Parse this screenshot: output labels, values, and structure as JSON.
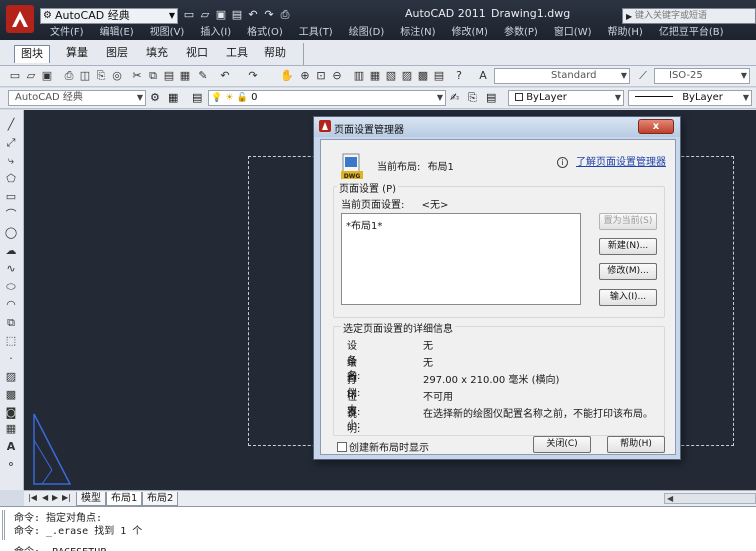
{
  "title_bar": {
    "workspace": "AutoCAD 经典",
    "app_name": "AutoCAD 2011",
    "document": "Drawing1.dwg",
    "search_placeholder": "键入关键字或短语"
  },
  "menu": [
    "文件(F)",
    "编辑(E)",
    "视图(V)",
    "插入(I)",
    "格式(O)",
    "工具(T)",
    "绘图(D)",
    "标注(N)",
    "修改(M)",
    "参数(P)",
    "窗口(W)",
    "帮助(H)",
    "亿把豆平台(B)"
  ],
  "ribbon_tabs": [
    "图块",
    "算量",
    "图层",
    "填充",
    "视口",
    "工具",
    "帮助"
  ],
  "toolbar": {
    "text_style": "Standard",
    "dim_style": "ISO-25",
    "workspace_combo": "AutoCAD 经典",
    "layer_value": "0",
    "color": "ByLayer",
    "linetype": "ByLayer"
  },
  "layout_tabs": [
    "模型",
    "布局1",
    "布局2"
  ],
  "command_line": {
    "line1": "命令: 指定对角点:",
    "line2": "命令: _.erase 找到 1 个",
    "line3": "命令: _PAGESETUP"
  },
  "dialog": {
    "title": "页面设置管理器",
    "close_label": "x",
    "current_layout_label": "当前布局:",
    "current_layout_value": "布局1",
    "learn_link": "了解页面设置管理器",
    "page_setup_group": "页面设置 (P)",
    "current_page_setup_label": "当前页面设置:",
    "current_page_setup_value": "<无>",
    "list_items": [
      "*布局1*"
    ],
    "btn_set_current": "置为当前(S)",
    "btn_new": "新建(N)...",
    "btn_modify": "修改(M)...",
    "btn_import": "输入(I)...",
    "details_group": "选定页面设置的详细信息",
    "details": [
      {
        "label": "设备名:",
        "value": "无"
      },
      {
        "label": "绘图仪:",
        "value": "无"
      },
      {
        "label": "打印大小:",
        "value": "297.00 x 210.00 毫米 (横向)"
      },
      {
        "label": "位置:",
        "value": "不可用"
      },
      {
        "label": "说明:",
        "value": "在选择新的绘图仪配置名称之前，不能打印该布局。"
      }
    ],
    "checkbox_label": "创建新布局时显示",
    "btn_close": "关闭(C)",
    "btn_help": "帮助(H)"
  }
}
